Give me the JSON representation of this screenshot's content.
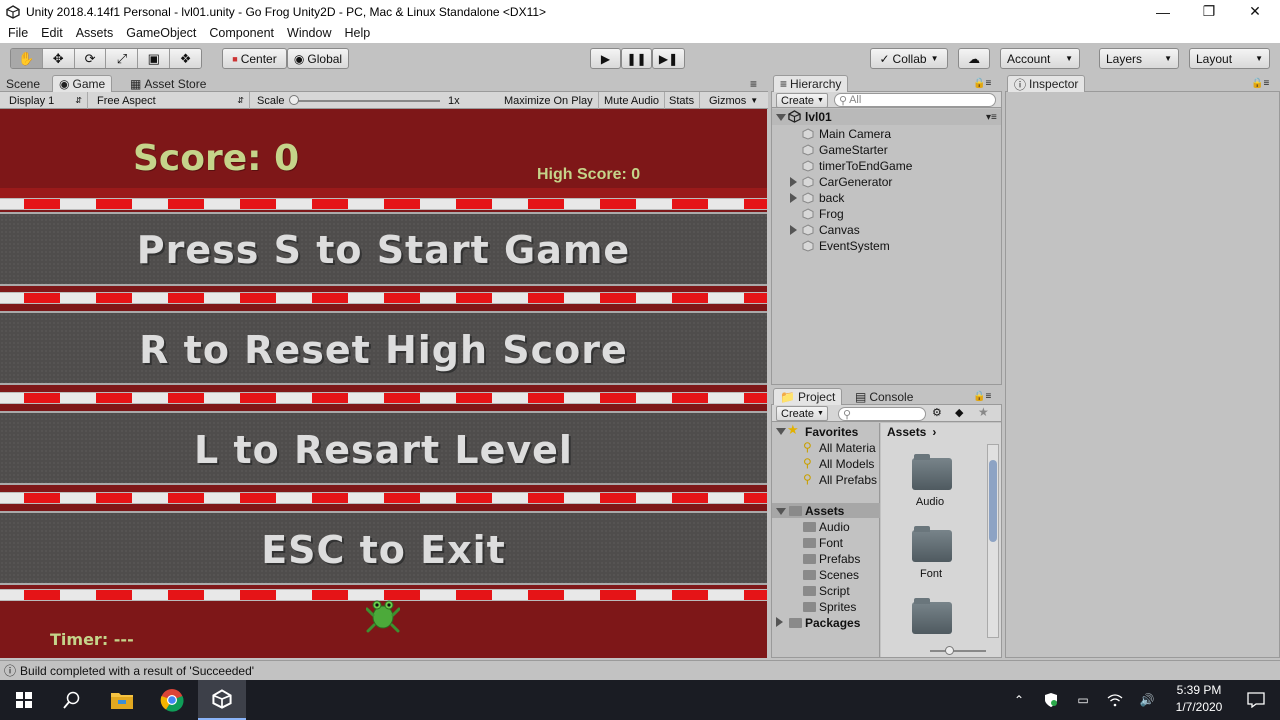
{
  "window": {
    "title": "Unity 2018.4.14f1 Personal - lvl01.unity - Go Frog Unity2D - PC, Mac & Linux Standalone <DX11>"
  },
  "menu": [
    "File",
    "Edit",
    "Assets",
    "GameObject",
    "Component",
    "Window",
    "Help"
  ],
  "toolbar": {
    "center_label": "Center",
    "global_label": "Global",
    "collab_label": "Collab",
    "account_label": "Account",
    "layers_label": "Layers",
    "layout_label": "Layout"
  },
  "tabs": {
    "scene": "Scene",
    "game": "Game",
    "asset_store": "Asset Store",
    "hierarchy": "Hierarchy",
    "inspector": "Inspector",
    "project": "Project",
    "console": "Console"
  },
  "gamebar": {
    "display": "Display 1",
    "aspect": "Free Aspect",
    "scale_label": "Scale",
    "scale_value": "1x",
    "maximize": "Maximize On Play",
    "mute": "Mute Audio",
    "stats": "Stats",
    "gizmos": "Gizmos"
  },
  "game": {
    "score": "Score: 0",
    "high_score": "High Score: 0",
    "line1": "Press S to Start Game",
    "line2": "R to Reset High Score",
    "line3": "L to Resart Level",
    "line4": "ESC to Exit",
    "timer": "Timer: ---"
  },
  "hierarchy": {
    "create_label": "Create",
    "search_placeholder": "All",
    "scene_name": "lvl01",
    "items": [
      {
        "label": "Main Camera",
        "expandable": false
      },
      {
        "label": "GameStarter",
        "expandable": false
      },
      {
        "label": "timerToEndGame",
        "expandable": false
      },
      {
        "label": "CarGenerator",
        "expandable": true
      },
      {
        "label": "back",
        "expandable": true
      },
      {
        "label": "Frog",
        "expandable": false
      },
      {
        "label": "Canvas",
        "expandable": true
      },
      {
        "label": "EventSystem",
        "expandable": false
      }
    ]
  },
  "project": {
    "create_label": "Create",
    "favorites_label": "Favorites",
    "favorites": [
      "All Materia",
      "All Models",
      "All Prefabs"
    ],
    "assets_label": "Assets",
    "asset_folders": [
      "Audio",
      "Font",
      "Prefabs",
      "Scenes",
      "Script",
      "Sprites"
    ],
    "packages_label": "Packages",
    "breadcrumb": "Assets",
    "grid_items": [
      "Audio",
      "Font",
      ""
    ]
  },
  "status": {
    "message": "Build completed with a result of 'Succeeded'"
  },
  "taskbar": {
    "time": "5:39 PM",
    "date": "1/7/2020"
  },
  "colors": {
    "game_bg": "#7e1718",
    "score_text": "#c5d48a",
    "stripe_red": "#e51417",
    "road": "#4f4d4c"
  }
}
